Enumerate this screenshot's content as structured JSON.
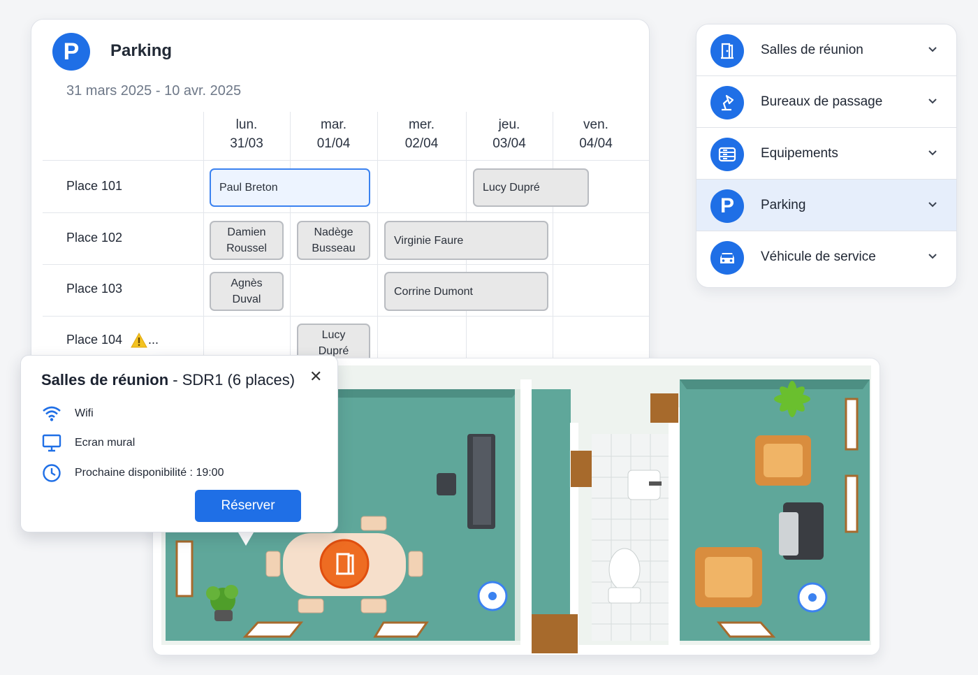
{
  "schedule": {
    "title": "Parking",
    "badge": "P",
    "date_range": "31 mars 2025 - 10 avr. 2025",
    "days": [
      {
        "dow": "lun.",
        "date": "31/03"
      },
      {
        "dow": "mar.",
        "date": "01/04"
      },
      {
        "dow": "mer.",
        "date": "02/04"
      },
      {
        "dow": "jeu.",
        "date": "03/04"
      },
      {
        "dow": "ven.",
        "date": "04/04"
      }
    ],
    "places": [
      {
        "label": "Place 101"
      },
      {
        "label": "Place 102"
      },
      {
        "label": "Place 103"
      },
      {
        "label": "Place 104",
        "suffix": "..."
      }
    ],
    "reservations": [
      {
        "name": "Paul Breton"
      },
      {
        "name": "Lucy Dupré"
      },
      {
        "name_l1": "Damien",
        "name_l2": "Roussel"
      },
      {
        "name_l1": "Nadège",
        "name_l2": "Busseau"
      },
      {
        "name": "Virginie Faure"
      },
      {
        "name_l1": "Agnès",
        "name_l2": "Duval"
      },
      {
        "name": "Corrine Dumont"
      },
      {
        "name_l1": "Lucy",
        "name_l2": "Dupré"
      }
    ]
  },
  "menu": {
    "items": [
      {
        "label": "Salles de réunion",
        "icon": "door-icon"
      },
      {
        "label": "Bureaux de passage",
        "icon": "desk-lamp-icon"
      },
      {
        "label": "Equipements",
        "icon": "equipment-icon"
      },
      {
        "label": "Parking",
        "icon": "parking-icon",
        "badge": "P",
        "active": true
      },
      {
        "label": "Véhicule de service",
        "icon": "car-icon"
      }
    ]
  },
  "popup": {
    "title_bold": "Salles de réunion",
    "title_rest": " - SDR1 (6 places)",
    "close": "✕",
    "features": [
      {
        "icon": "wifi-icon",
        "label": "Wifi"
      },
      {
        "icon": "monitor-icon",
        "label": "Ecran mural"
      },
      {
        "icon": "clock-icon",
        "label": "Prochaine disponibilité : 19:00"
      }
    ],
    "book_label": "Réserver"
  },
  "colors": {
    "accent": "#1f6fe6",
    "room_floor": "#5fa79a",
    "table": "#f6dfcb",
    "marker": "#ee6c22"
  }
}
